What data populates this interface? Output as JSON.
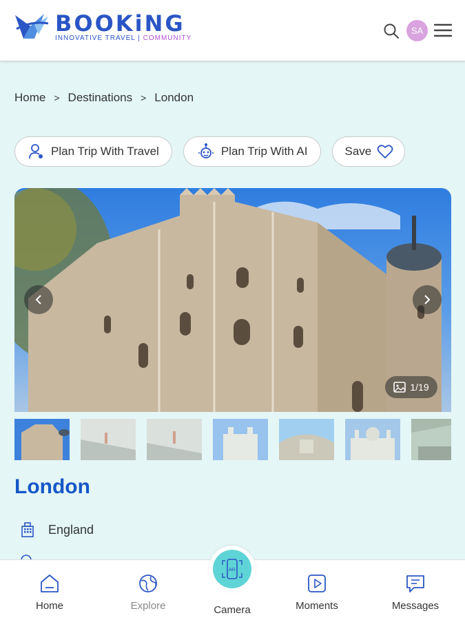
{
  "header": {
    "brand_title": "BOOKiNG",
    "brand_sub_a": "INNOVATIVE TRAVEL",
    "brand_sub_b": "COMMUNITY",
    "avatar_initials": "SA"
  },
  "breadcrumb": {
    "items": [
      "Home",
      "Destinations",
      "London"
    ],
    "separator": ">"
  },
  "actions": {
    "plan_travel": "Plan Trip With Travel",
    "plan_ai": "Plan Trip With AI",
    "save": "Save"
  },
  "gallery": {
    "counter": "1/19",
    "prev_icon": "chevron-left-icon",
    "next_icon": "chevron-right-icon",
    "thumbnail_count_visible": 7
  },
  "place": {
    "title": "London",
    "country": "England"
  },
  "bottom_nav": {
    "home": "Home",
    "explore": "Explore",
    "camera": "Camera",
    "moments": "Moments",
    "messages": "Messages"
  },
  "colors": {
    "brand_blue": "#2a55c5",
    "title_blue": "#1557c8",
    "accent_pink": "#b34fd6",
    "avatar_bg": "#d9a3df",
    "page_bg": "#e4f6f6",
    "camera_teal": "#5fd4d6"
  }
}
